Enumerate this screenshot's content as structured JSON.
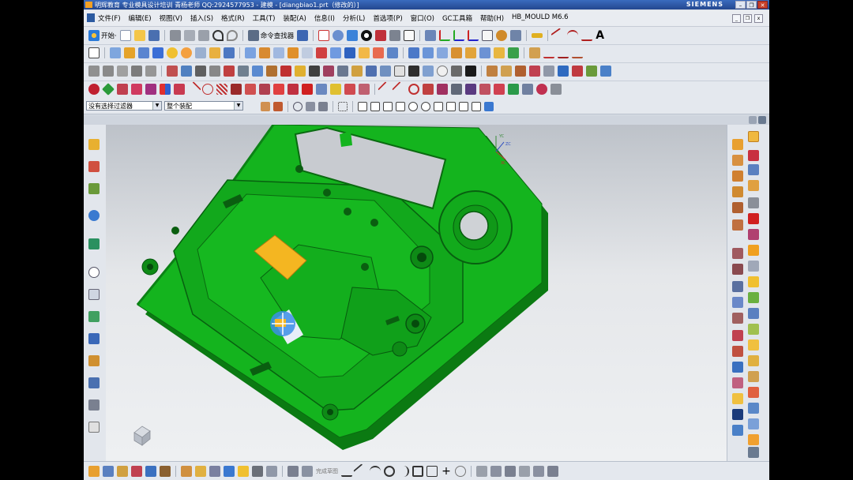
{
  "window": {
    "title": "明辉教育 专业模具设计培训 青杨老师 QQ:2924577953 - 建模 - [diangbiao1.prt（修改的）]",
    "brand": "SIEMENS",
    "buttons": [
      "–",
      "❐",
      "✕"
    ]
  },
  "menu": [
    "文件(F)",
    "编辑(E)",
    "视图(V)",
    "插入(S)",
    "格式(R)",
    "工具(T)",
    "装配(A)",
    "信息(I)",
    "分析(L)",
    "首选项(P)",
    "窗口(O)",
    "GC工具箱",
    "帮助(H)",
    "HB_MOULD M6.6"
  ],
  "toolbar1": {
    "start_label": "开始·",
    "command_finder_label": "命令查找器"
  },
  "selection_bar": {
    "filter_value": "没有选择过滤器",
    "assembly_value": "整个装配"
  },
  "statusbar": {
    "label": "完成草图"
  },
  "colors": {
    "part_green": "#14b41e",
    "part_dark": "#0b7a12",
    "highlight_orange": "#f4b621",
    "titlebar": "#2f5aa8"
  },
  "icons": {
    "view_triad": "xyz-triad-icon",
    "wcs": "wcs-icon"
  }
}
